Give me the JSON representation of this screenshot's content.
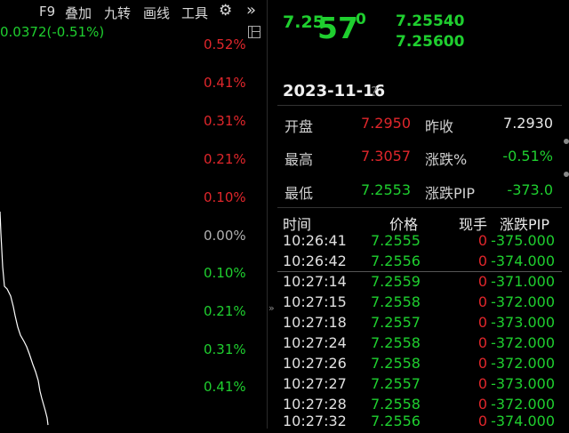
{
  "toolbar": {
    "f9": "F9",
    "overlay": "叠加",
    "nine_turns": "九转",
    "draw_line": "画线",
    "tools": "工具"
  },
  "chart": {
    "change_text": "0.0372(-0.51%)",
    "pct_axis": [
      "0.52%",
      "0.41%",
      "0.31%",
      "0.21%",
      "0.10%",
      "0.00%",
      "0.10%",
      "0.21%",
      "0.31%",
      "0.41%"
    ],
    "pct_colors": [
      "#e0262b",
      "#e0262b",
      "#e0262b",
      "#e0262b",
      "#e0262b",
      "#b0b0b0",
      "#1fcf2f",
      "#1fcf2f",
      "#1fcf2f",
      "#1fcf2f"
    ],
    "line_color": "#ffffff"
  },
  "quote": {
    "price_prefix": "7.25",
    "price_big": "57",
    "price_sup": "0",
    "bid": "7.25540",
    "ask": "7.25600"
  },
  "date": "2023-11-16",
  "date_help": "?",
  "stats": {
    "open_label": "开盘",
    "open_value": "7.2950",
    "prev_close_label": "昨收",
    "prev_close_value": "7.2930",
    "high_label": "最高",
    "high_value": "7.3057",
    "change_pct_label": "涨跌%",
    "change_pct_value": "-0.51%",
    "low_label": "最低",
    "low_value": "7.2553",
    "change_pip_label": "涨跌PIP",
    "change_pip_value": "-373.0"
  },
  "trades": {
    "headers": {
      "time": "时间",
      "price": "价格",
      "volume": "现手",
      "pip": "涨跌PIP"
    },
    "rows": [
      {
        "time": "10:26:41",
        "price": "7.2555",
        "volume": "0",
        "pip": "-375.000"
      },
      {
        "time": "10:26:42",
        "price": "7.2556",
        "volume": "0",
        "pip": "-374.000"
      },
      {
        "time": "10:27:14",
        "price": "7.2559",
        "volume": "0",
        "pip": "-371.000"
      },
      {
        "time": "10:27:15",
        "price": "7.2558",
        "volume": "0",
        "pip": "-372.000"
      },
      {
        "time": "10:27:18",
        "price": "7.2557",
        "volume": "0",
        "pip": "-373.000"
      },
      {
        "time": "10:27:24",
        "price": "7.2558",
        "volume": "0",
        "pip": "-372.000"
      },
      {
        "time": "10:27:26",
        "price": "7.2558",
        "volume": "0",
        "pip": "-372.000"
      },
      {
        "time": "10:27:27",
        "price": "7.2557",
        "volume": "0",
        "pip": "-373.000"
      },
      {
        "time": "10:27:28",
        "price": "7.2558",
        "volume": "0",
        "pip": "-372.000"
      },
      {
        "time": "10:27:32",
        "price": "7.2556",
        "volume": "0",
        "pip": "-374.000"
      }
    ]
  }
}
